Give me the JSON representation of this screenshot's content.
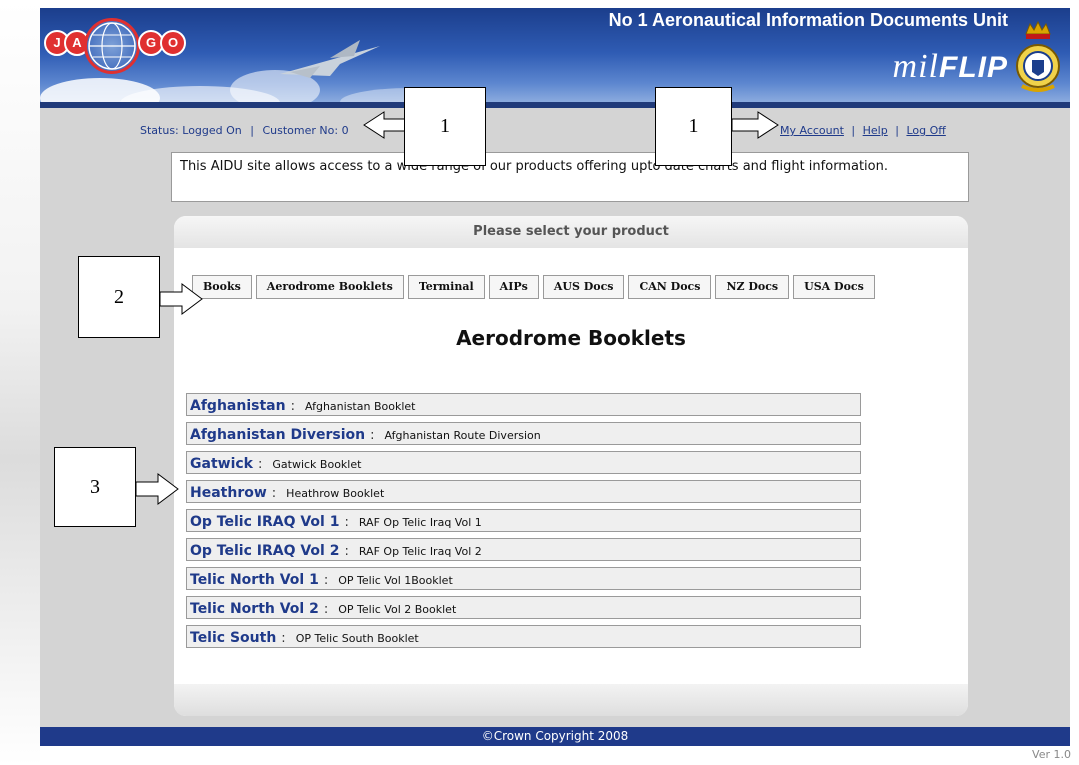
{
  "header": {
    "logo_left": [
      "J",
      "A"
    ],
    "logo_right": [
      "G",
      "O"
    ],
    "title": "No 1 Aeronautical Information Documents Unit",
    "brand_prefix": "mil",
    "brand_main": "FLIP"
  },
  "status": {
    "text": "Status: Logged On",
    "separator": "|",
    "customer": "Customer No: 0"
  },
  "account_links": {
    "my_account": "My Account",
    "help": "Help",
    "log_off": "Log Off",
    "separator": "|"
  },
  "intro": "This AIDU site allows access to a wide range of our products offering upto date charts and flight information.",
  "panel": {
    "heading": "Please select your product",
    "section_title": "Aerodrome Booklets"
  },
  "tabs": [
    {
      "label": "Books"
    },
    {
      "label": "Aerodrome Booklets"
    },
    {
      "label": "Terminal"
    },
    {
      "label": "AIPs"
    },
    {
      "label": "AUS Docs"
    },
    {
      "label": "CAN Docs"
    },
    {
      "label": "NZ Docs"
    },
    {
      "label": "USA Docs"
    }
  ],
  "booklets": [
    {
      "name": "Afghanistan",
      "sep": ":",
      "desc": "Afghanistan Booklet"
    },
    {
      "name": "Afghanistan Diversion",
      "sep": ":",
      "desc": "Afghanistan Route Diversion"
    },
    {
      "name": "Gatwick",
      "sep": ":",
      "desc": "Gatwick Booklet"
    },
    {
      "name": "Heathrow",
      "sep": ":",
      "desc": "Heathrow Booklet"
    },
    {
      "name": "Op Telic IRAQ Vol 1",
      "sep": ":",
      "desc": "RAF Op Telic Iraq Vol 1"
    },
    {
      "name": "Op Telic IRAQ Vol 2",
      "sep": ":",
      "desc": "RAF Op Telic Iraq Vol 2"
    },
    {
      "name": "Telic North Vol 1",
      "sep": ":",
      "desc": "OP Telic Vol 1Booklet"
    },
    {
      "name": "Telic North Vol 2",
      "sep": ":",
      "desc": "OP Telic Vol 2 Booklet"
    },
    {
      "name": "Telic South",
      "sep": ":",
      "desc": "OP Telic South Booklet"
    }
  ],
  "footer": "©Crown Copyright 2008",
  "version": "Ver 1.0",
  "callouts": {
    "status_callout": "1",
    "account_callout": "1",
    "tabs_callout": "2",
    "list_callout": "3"
  },
  "colors": {
    "header_blue": "#2f5cb4",
    "footer_blue": "#1f3a8a",
    "link_blue": "#1f3a8a",
    "logo_red": "#e03030",
    "page_gray": "#d4d4d4"
  }
}
